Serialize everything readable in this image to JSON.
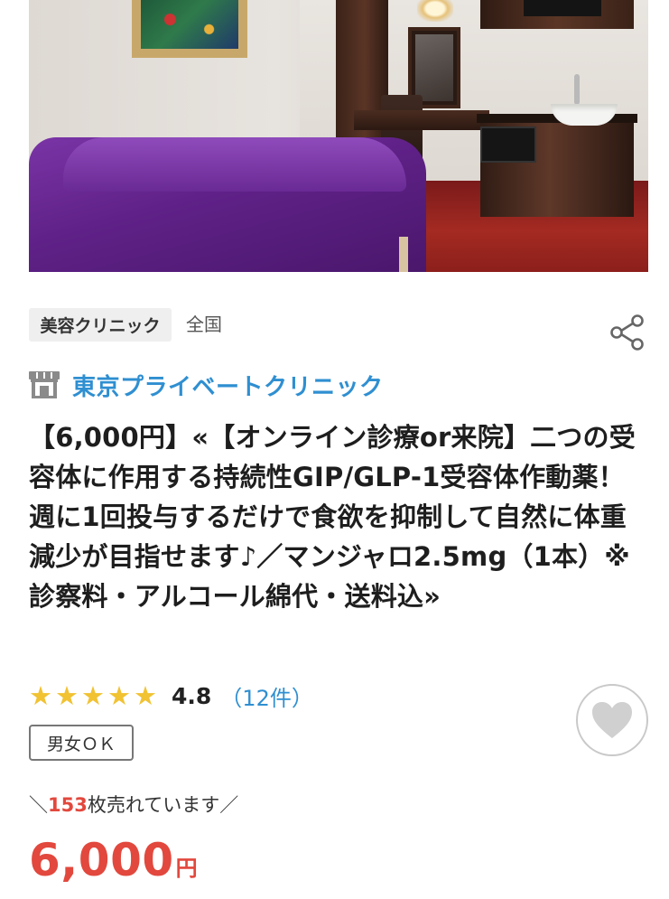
{
  "hero": {
    "image": "clinic-treatment-room-photo"
  },
  "meta": {
    "category": "美容クリニック",
    "region": "全国",
    "share_icon": "share-icon"
  },
  "clinic": {
    "icon": "shop-icon",
    "name": "東京プライベートクリニック"
  },
  "title": "【6,000円】«【オンライン診療or来院】二つの受容体に作用する持続性GIP/GLP-1受容体作動薬！週に1回投与するだけで食欲を抑制して自然に体重減少が目指せます♪／マンジャロ2.5mg（1本）※診察料・アルコール綿代・送料込»",
  "rating": {
    "stars": 5,
    "score": "4.8",
    "count": "（12件）",
    "star_color": "#f1c232"
  },
  "gender_tag": "男女ＯＫ",
  "favorite": {
    "icon": "heart-icon"
  },
  "sold": {
    "prefix": "＼",
    "count": "153",
    "suffix": "枚売れています／"
  },
  "price": {
    "value": "6,000",
    "unit": "円",
    "color": "#e2483d"
  },
  "colors": {
    "link": "#2f8fd1",
    "accent": "#e2483d"
  }
}
